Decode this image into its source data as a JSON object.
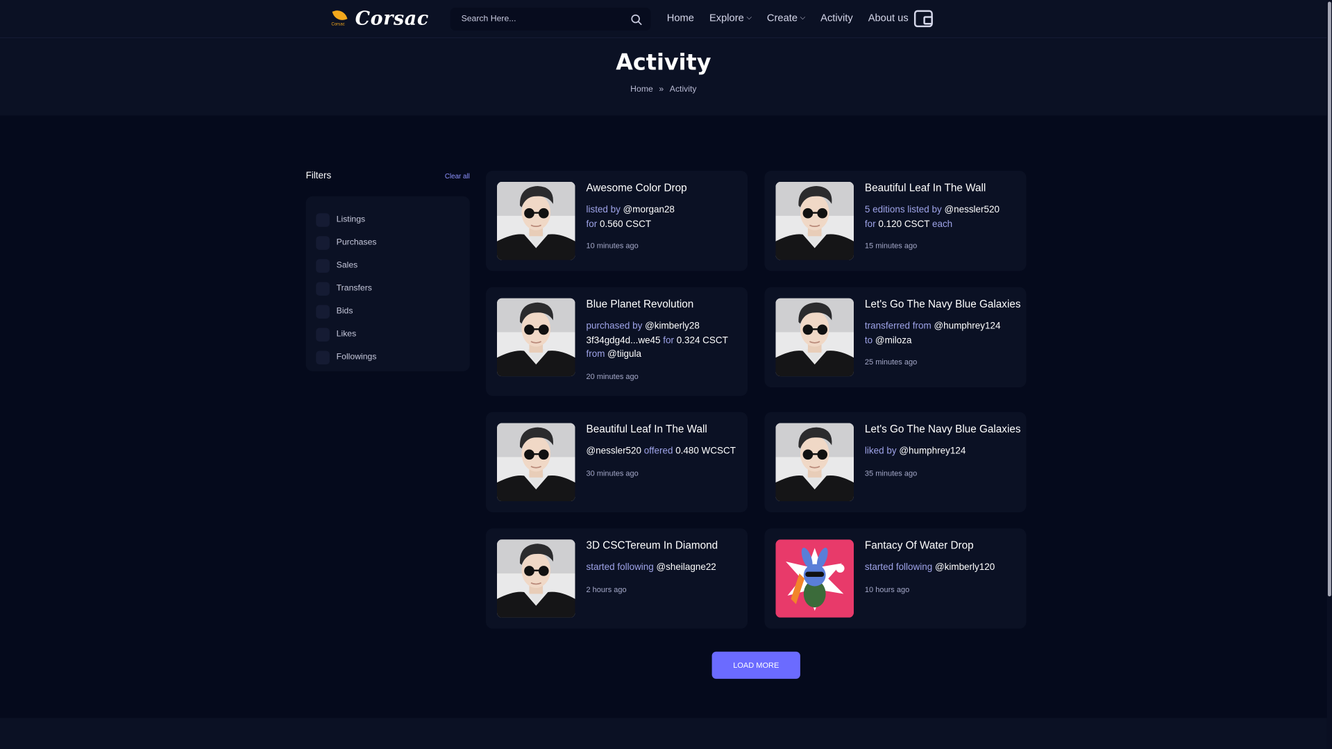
{
  "brand": {
    "name": "Corsac",
    "tagline": "Corsac"
  },
  "search": {
    "placeholder": "Search Here..."
  },
  "nav": {
    "home": "Home",
    "explore": "Explore",
    "create": "Create",
    "activity": "Activity",
    "about": "About us"
  },
  "hero": {
    "title": "Activity",
    "breadcrumb": [
      "Home",
      "Activity"
    ]
  },
  "filters": {
    "title": "Filters",
    "clear_label": "Clear all",
    "items": [
      "Listings",
      "Purchases",
      "Sales",
      "Transfers",
      "Bids",
      "Likes",
      "Followings"
    ]
  },
  "activities": [
    {
      "title": "Awesome Color Drop",
      "line1": [
        [
          "t",
          "listed by "
        ],
        [
          "b",
          "@morgan28"
        ]
      ],
      "line2": [
        [
          "t",
          "for "
        ],
        [
          "b",
          "0.560 CSCT"
        ]
      ],
      "line3": [],
      "time": "10 minutes ago",
      "avatar": "man-sunglasses"
    },
    {
      "title": "Beautiful Leaf In The Wall",
      "line1": [
        [
          "t",
          "5 editions listed by "
        ],
        [
          "b",
          "@nessler520"
        ]
      ],
      "line2": [
        [
          "t",
          "for "
        ],
        [
          "b",
          "0.120 CSCT"
        ],
        [
          "t",
          " each"
        ]
      ],
      "line3": [],
      "time": "15 minutes ago",
      "avatar": "man-sunglasses"
    },
    {
      "title": "Blue Planet Revolution",
      "line1": [
        [
          "t",
          "purchased by "
        ],
        [
          "b",
          "@kimberly28"
        ]
      ],
      "line2": [
        [
          "b",
          "3f34gdg4d...we45"
        ],
        [
          "t",
          " for "
        ],
        [
          "b",
          "0.324 CSCT"
        ]
      ],
      "line3": [
        [
          "t",
          "from "
        ],
        [
          "b",
          "@tiigula"
        ]
      ],
      "time": "20 minutes ago",
      "avatar": "man-sunglasses"
    },
    {
      "title": "Let's Go The Navy Blue Galaxies",
      "line1": [
        [
          "t",
          "transferred from "
        ],
        [
          "b",
          "@humphrey124"
        ]
      ],
      "line2": [
        [
          "t",
          "to "
        ],
        [
          "b",
          "@miloza"
        ]
      ],
      "line3": [],
      "time": "25 minutes ago",
      "avatar": "man-sunglasses"
    },
    {
      "title": "Beautiful Leaf In The Wall",
      "line1": [
        [
          "b",
          "@nessler520"
        ],
        [
          "t",
          " offered "
        ],
        [
          "b",
          "0.480 WCSCT"
        ]
      ],
      "line2": [],
      "line3": [],
      "time": "30 minutes ago",
      "avatar": "man-sunglasses"
    },
    {
      "title": "Let's Go The Navy Blue Galaxies",
      "line1": [
        [
          "t",
          "liked by "
        ],
        [
          "b",
          "@humphrey124"
        ]
      ],
      "line2": [],
      "line3": [],
      "time": "35 minutes ago",
      "avatar": "man-sunglasses"
    },
    {
      "title": "3D CSCTereum In Diamond",
      "line1": [
        [
          "t",
          "started following "
        ],
        [
          "b",
          "@sheilagne22"
        ]
      ],
      "line2": [],
      "line3": [],
      "time": "2 hours ago",
      "avatar": "man-sunglasses"
    },
    {
      "title": "Fantacy Of Water Drop",
      "line1": [
        [
          "t",
          "started following "
        ],
        [
          "b",
          "@kimberly120"
        ]
      ],
      "line2": [],
      "line3": [],
      "time": "10 hours ago",
      "avatar": "cartoon-bunny"
    }
  ],
  "load_more_label": "LOAD MORE",
  "colors": {
    "background": "#050a1c",
    "panel": "#0b1124",
    "accent": "#6b6bff",
    "muted_text": "#9ea3e8"
  }
}
